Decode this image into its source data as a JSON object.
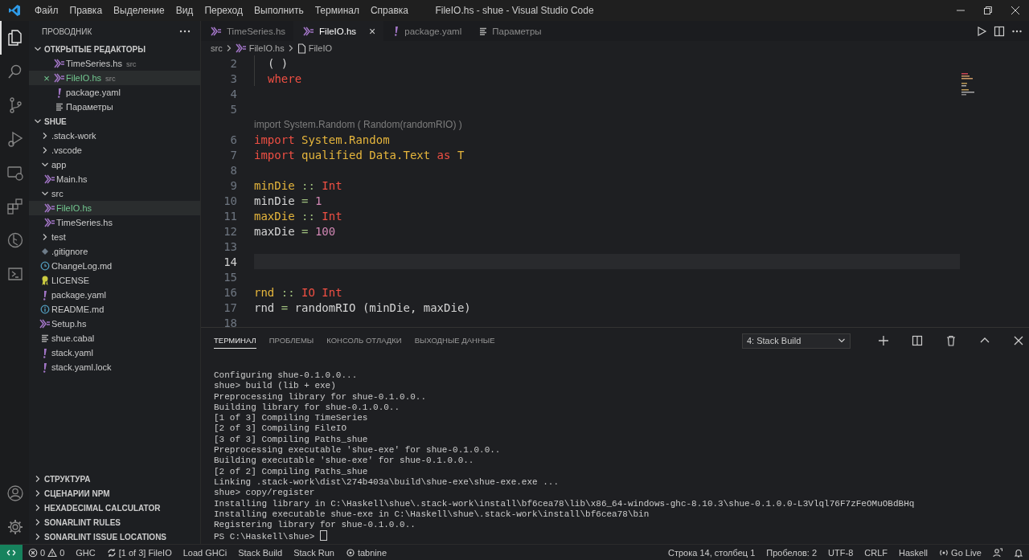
{
  "title_bar": {
    "menu": [
      "Файл",
      "Правка",
      "Выделение",
      "Вид",
      "Переход",
      "Выполнить",
      "Терминал",
      "Справка"
    ],
    "title": "FileIO.hs - shue - Visual Studio Code"
  },
  "activity_bar": {
    "items": [
      {
        "kind": "files",
        "selected": true
      },
      {
        "kind": "search",
        "selected": false
      },
      {
        "kind": "source-control",
        "selected": false
      },
      {
        "kind": "run",
        "selected": false
      },
      {
        "kind": "remote",
        "selected": false
      },
      {
        "kind": "extensions",
        "selected": false
      },
      {
        "kind": "graph",
        "selected": false
      },
      {
        "kind": "terminal",
        "selected": false
      }
    ],
    "bottom": [
      {
        "kind": "account"
      },
      {
        "kind": "settings"
      }
    ]
  },
  "sidebar": {
    "title": "ПРОВОДНИК",
    "open_editors": {
      "title": "ОТКРЫТЫЕ РЕДАКТОРЫ",
      "expanded": true,
      "items": [
        {
          "kind": "haskell",
          "label": "TimeSeries.hs",
          "description": "src",
          "selected": false,
          "untracked": false
        },
        {
          "kind": "haskell",
          "label": "FileIO.hs",
          "description": "src",
          "selected": true,
          "untracked": true,
          "close_glyph": "×"
        },
        {
          "kind": "yaml",
          "label": "package.yaml",
          "selected": false,
          "untracked": false
        },
        {
          "kind": "settings",
          "label": "Параметры",
          "selected": false,
          "untracked": false
        }
      ]
    },
    "workspace": {
      "title": "SHUE",
      "expanded": true,
      "items": [
        {
          "kind": "folder",
          "label": ".stack-work",
          "expanded": false,
          "selected": false
        },
        {
          "kind": "folder",
          "label": ".vscode",
          "expanded": false,
          "selected": false
        },
        {
          "kind": "folder",
          "label": "app",
          "expanded": true,
          "selected": false,
          "children": [
            {
              "kind": "haskell",
              "label": "Main.hs",
              "selected": false,
              "untracked": false
            }
          ]
        },
        {
          "kind": "folder",
          "label": "src",
          "expanded": true,
          "selected": false,
          "children": [
            {
              "kind": "haskell",
              "label": "FileIO.hs",
              "selected": true,
              "untracked": true
            },
            {
              "kind": "haskell",
              "label": "TimeSeries.hs",
              "selected": false,
              "untracked": false
            }
          ]
        },
        {
          "kind": "folder",
          "label": "test",
          "expanded": false,
          "selected": false
        },
        {
          "kind": "git",
          "label": ".gitignore",
          "selected": false,
          "untracked": false
        },
        {
          "kind": "changelog",
          "label": "ChangeLog.md",
          "selected": false,
          "untracked": false
        },
        {
          "kind": "license",
          "label": "LICENSE",
          "selected": false,
          "untracked": false
        },
        {
          "kind": "yaml",
          "label": "package.yaml",
          "selected": false,
          "untracked": false
        },
        {
          "kind": "readme",
          "label": "README.md",
          "selected": false,
          "untracked": false
        },
        {
          "kind": "haskell",
          "label": "Setup.hs",
          "selected": false,
          "untracked": false
        },
        {
          "kind": "cabal",
          "label": "shue.cabal",
          "selected": false,
          "untracked": false
        },
        {
          "kind": "yaml",
          "label": "stack.yaml",
          "selected": false,
          "untracked": false
        },
        {
          "kind": "yaml",
          "label": "stack.yaml.lock",
          "selected": false,
          "untracked": false
        }
      ]
    },
    "sections": [
      {
        "title": "СТРУКТУРА",
        "expanded": false
      },
      {
        "title": "СЦЕНАРИИ NPM",
        "expanded": false
      },
      {
        "title": "HEXADECIMAL CALCULATOR",
        "expanded": false
      },
      {
        "title": "SONARLINT RULES",
        "expanded": false
      },
      {
        "title": "SONARLINT ISSUE LOCATIONS",
        "expanded": false
      }
    ]
  },
  "editor": {
    "tabs": [
      {
        "kind": "haskell",
        "label": "TimeSeries.hs",
        "selected": false
      },
      {
        "kind": "haskell",
        "label": "FileIO.hs",
        "selected": true,
        "close_glyph": "×"
      },
      {
        "kind": "yaml",
        "label": "package.yaml",
        "selected": false
      },
      {
        "kind": "settings",
        "label": "Параметры",
        "selected": false
      }
    ],
    "actions": [
      {
        "kind": "run"
      },
      {
        "kind": "split"
      },
      {
        "kind": "more"
      }
    ],
    "breadcrumb": [
      {
        "kind": "folder",
        "label": "src"
      },
      {
        "kind": "haskell",
        "label": "FileIO.hs"
      },
      {
        "kind": "symbol-file",
        "label": "FileIO"
      }
    ],
    "lines": [
      {
        "kind": "code",
        "number": "2",
        "indent": true,
        "current": false,
        "tokens": [
          {
            "kind": "plain",
            "text": "( )"
          }
        ]
      },
      {
        "kind": "code",
        "number": "3",
        "indent": true,
        "current": false,
        "tokens": [
          {
            "kind": "keyword",
            "text": "where"
          }
        ]
      },
      {
        "kind": "code",
        "number": "4",
        "indent": false,
        "current": false
      },
      {
        "kind": "code",
        "number": "5",
        "indent": false,
        "current": false
      },
      {
        "kind": "codelens",
        "text": "import System.Random ( Random(randomRIO) )"
      },
      {
        "kind": "code",
        "number": "6",
        "indent": false,
        "current": false,
        "tokens": [
          {
            "kind": "keyword",
            "text": "import"
          },
          {
            "kind": "name",
            "text": "System.Random"
          }
        ]
      },
      {
        "kind": "code",
        "number": "7",
        "indent": false,
        "current": false,
        "tokens": [
          {
            "kind": "keyword",
            "text": "import"
          },
          {
            "kind": "name",
            "text": "qualified"
          },
          {
            "kind": "name",
            "text": "Data.Text"
          },
          {
            "kind": "keyword",
            "text": "as"
          },
          {
            "kind": "name",
            "text": "T"
          }
        ]
      },
      {
        "kind": "code",
        "number": "8",
        "indent": false,
        "current": false
      },
      {
        "kind": "code",
        "number": "9",
        "indent": false,
        "current": false,
        "tokens": [
          {
            "kind": "name",
            "text": "minDie"
          },
          {
            "kind": "operator",
            "text": "::"
          },
          {
            "kind": "keyword",
            "text": "Int"
          }
        ]
      },
      {
        "kind": "code",
        "number": "10",
        "indent": false,
        "current": false,
        "tokens": [
          {
            "kind": "plain",
            "text": "minDie"
          },
          {
            "kind": "operator",
            "text": "="
          },
          {
            "kind": "number",
            "text": "1"
          }
        ]
      },
      {
        "kind": "code",
        "number": "11",
        "indent": false,
        "current": false,
        "tokens": [
          {
            "kind": "name",
            "text": "maxDie"
          },
          {
            "kind": "operator",
            "text": "::"
          },
          {
            "kind": "keyword",
            "text": "Int"
          }
        ]
      },
      {
        "kind": "code",
        "number": "12",
        "indent": false,
        "current": false,
        "tokens": [
          {
            "kind": "plain",
            "text": "maxDie"
          },
          {
            "kind": "operator",
            "text": "="
          },
          {
            "kind": "number",
            "text": "100"
          }
        ]
      },
      {
        "kind": "code",
        "number": "13",
        "indent": false,
        "current": false
      },
      {
        "kind": "code",
        "number": "14",
        "indent": false,
        "current": true
      },
      {
        "kind": "code",
        "number": "15",
        "indent": false,
        "current": false
      },
      {
        "kind": "code",
        "number": "16",
        "indent": false,
        "current": false,
        "tokens": [
          {
            "kind": "name",
            "text": "rnd"
          },
          {
            "kind": "operator",
            "text": "::"
          },
          {
            "kind": "keyword",
            "text": "IO"
          },
          {
            "kind": "keyword",
            "text": "Int"
          }
        ]
      },
      {
        "kind": "code",
        "number": "17",
        "indent": false,
        "current": false,
        "tokens": [
          {
            "kind": "plain",
            "text": "rnd"
          },
          {
            "kind": "operator",
            "text": "="
          },
          {
            "kind": "plain",
            "text": "randomRIO (minDie, maxDie)"
          }
        ]
      },
      {
        "kind": "code",
        "number": "18",
        "indent": false,
        "current": false
      }
    ]
  },
  "panel": {
    "tabs": [
      {
        "label": "ТЕРМИНАЛ",
        "selected": true
      },
      {
        "label": "ПРОБЛЕМЫ",
        "selected": false
      },
      {
        "label": "КОНСОЛЬ ОТЛАДКИ",
        "selected": false
      },
      {
        "label": "ВЫХОДНЫЕ ДАННЫЕ",
        "selected": false
      }
    ],
    "terminal_selector": {
      "value": "4: Stack Build"
    },
    "actions": [
      {
        "kind": "plus"
      },
      {
        "kind": "split"
      },
      {
        "kind": "trash"
      },
      {
        "kind": "maximize"
      },
      {
        "kind": "close"
      }
    ],
    "terminal": {
      "cursor": true,
      "lines": [
        "Configuring shue-0.1.0.0...",
        "shue> build (lib + exe)",
        "Preprocessing library for shue-0.1.0.0..",
        "Building library for shue-0.1.0.0..",
        "[1 of 3] Compiling TimeSeries",
        "[2 of 3] Compiling FileIO",
        "[3 of 3] Compiling Paths_shue",
        "Preprocessing executable 'shue-exe' for shue-0.1.0.0..",
        "Building executable 'shue-exe' for shue-0.1.0.0..",
        "[2 of 2] Compiling Paths_shue",
        "Linking .stack-work\\dist\\274b403a\\build\\shue-exe\\shue-exe.exe ...",
        "shue> copy/register",
        "Installing library in C:\\Haskell\\shue\\.stack-work\\install\\bf6cea78\\lib\\x86_64-windows-ghc-8.10.3\\shue-0.1.0.0-L3Vlql76F7zFeOMuOBdBHq",
        "Installing executable shue-exe in C:\\Haskell\\shue\\.stack-work\\install\\bf6cea78\\bin",
        "Registering library for shue-0.1.0.0..",
        "PS C:\\Haskell\\shue> "
      ]
    }
  },
  "status_bar": {
    "left": [
      {
        "kind": "remote"
      },
      {
        "kind": "problems",
        "errors": "0",
        "warnings": "0"
      },
      {
        "kind": "text",
        "text": "GHC"
      },
      {
        "kind": "sync",
        "text": "[1 of 3] FileIO"
      },
      {
        "kind": "text",
        "text": "Load GHCi"
      },
      {
        "kind": "text",
        "text": "Stack Build"
      },
      {
        "kind": "text",
        "text": "Stack Run"
      },
      {
        "kind": "tabnine",
        "text": "tabnine"
      }
    ],
    "right": [
      {
        "kind": "text",
        "text": "Строка 14, столбец 1"
      },
      {
        "kind": "text",
        "text": "Пробелов: 2"
      },
      {
        "kind": "text",
        "text": "UTF-8"
      },
      {
        "kind": "text",
        "text": "CRLF"
      },
      {
        "kind": "text",
        "text": "Haskell"
      },
      {
        "kind": "golive",
        "text": "Go Live"
      },
      {
        "kind": "feedback"
      },
      {
        "kind": "bell"
      }
    ]
  }
}
